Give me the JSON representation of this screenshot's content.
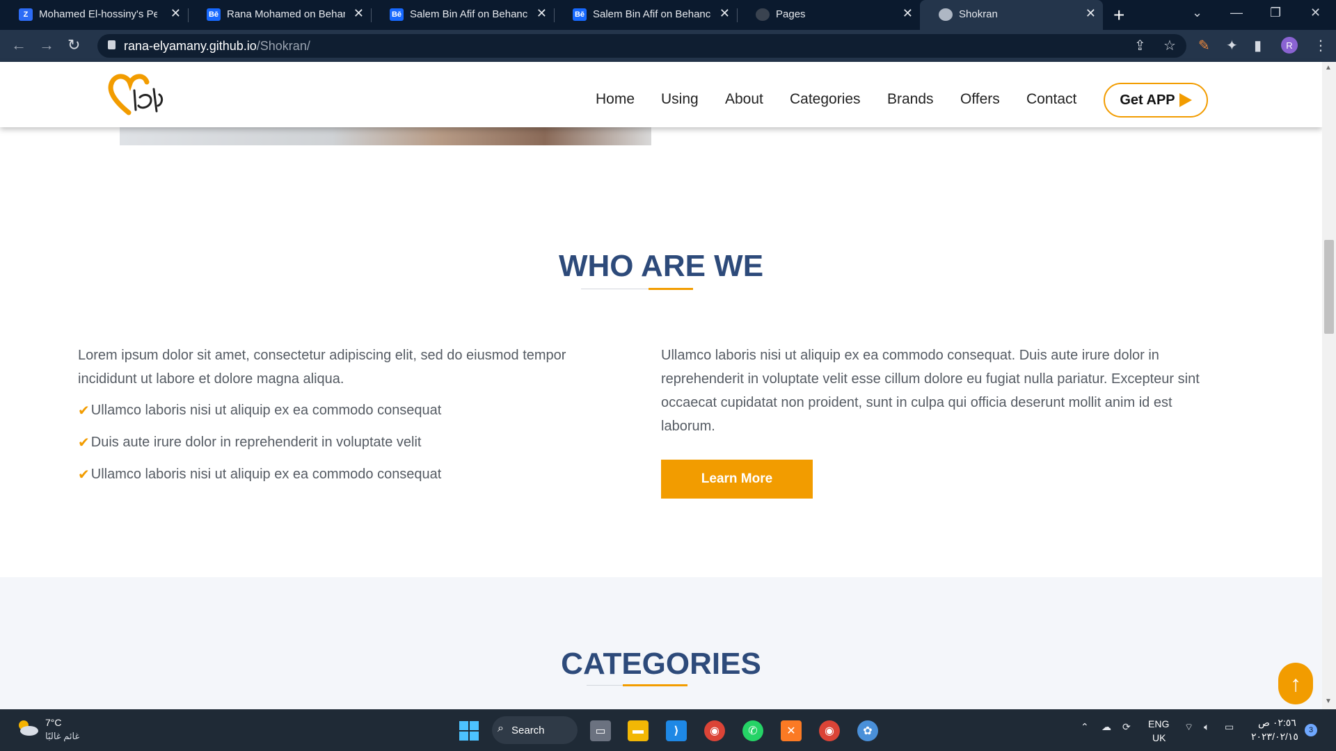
{
  "browser": {
    "tabs": [
      {
        "label": "Mohamed El-hossiny's Pers",
        "favicon": "Z"
      },
      {
        "label": "Rana Mohamed on Behance",
        "favicon": "Bē"
      },
      {
        "label": "Salem Bin Afif on Behance",
        "favicon": "Bē"
      },
      {
        "label": "Salem Bin Afif on Behance",
        "favicon": "Bē"
      },
      {
        "label": "Pages",
        "favicon": "github-icon"
      },
      {
        "label": "Shokran",
        "favicon": "globe-icon"
      }
    ],
    "url_host": "rana-elyamany.github.io",
    "url_path": "/Shokran/",
    "profile_initial": "R"
  },
  "site": {
    "nav": [
      "Home",
      "Using",
      "About",
      "Categories",
      "Brands",
      "Offers",
      "Contact"
    ],
    "get_app": "Get APP",
    "accent_color": "#f29c00",
    "title_color": "#2d4a7a"
  },
  "who": {
    "title": "WHO ARE WE",
    "left_para_1": "Lorem ipsum dolor sit amet, consectetur adipiscing elit, sed do eiusmod tempor",
    "left_para_2": "incididunt ut labore et dolore magna aliqua.",
    "checks": [
      "Ullamco laboris nisi ut aliquip ex ea commodo consequat",
      "Duis aute irure dolor in reprehenderit in voluptate velit",
      "Ullamco laboris nisi ut aliquip ex ea commodo consequat"
    ],
    "right_lines": [
      "Ullamco laboris nisi ut aliquip ex ea commodo consequat. Duis aute irure dolor in",
      "reprehenderit in voluptate velit esse cillum dolore eu fugiat nulla pariatur. Excepteur sint",
      "occaecat cupidatat non proident, sunt in culpa qui officia deserunt mollit anim id est",
      "laborum."
    ],
    "learn_more": "Learn More"
  },
  "categories": {
    "title": "CATEGORIES"
  },
  "taskbar": {
    "temp": "7°C",
    "weather_desc": "غائم غالبًا",
    "search": "Search",
    "lang_1": "ENG",
    "lang_2": "UK",
    "time": "٠٢:٥٦ ص",
    "date": "٢٠٢٣/٠٢/١٥",
    "notifications": "3"
  }
}
